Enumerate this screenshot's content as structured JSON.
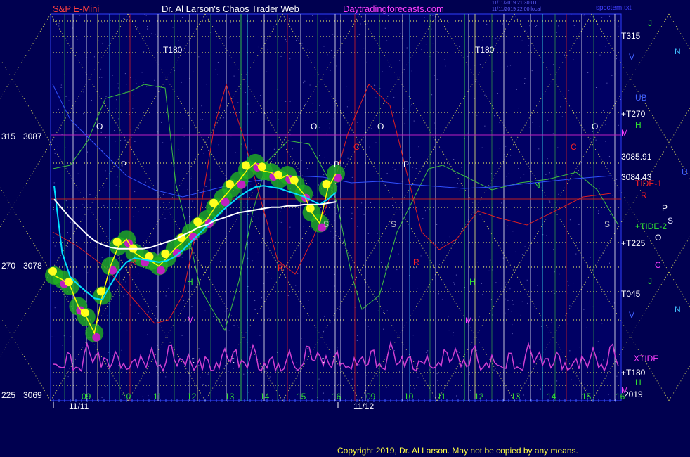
{
  "header": {
    "symbol": "S&P E-Mini",
    "title": "Dr. Al Larson's Chaos Trader Web",
    "site": "Daytradingforecasts.com",
    "stamp1": "11/11/2019 21:30 UT",
    "stamp2": "11/11/2019 22:00 local",
    "file": "spcctem.txt"
  },
  "copyright": "Copyright 2019, Dr. Al Larson. May not be copied by any means.",
  "colors": {
    "background": "#000050",
    "plot": "#000064",
    "price": "#ffff00",
    "ema": "#00e0ff",
    "sma": "#ffffff",
    "green_line": "#40c040",
    "red_line": "#e02020",
    "tide": "#d040d0",
    "grid": "#ffff60"
  },
  "chart_data": {
    "type": "line",
    "title": "S&P E-Mini",
    "ylim": [
      3069,
      3090
    ],
    "y_ticks": [
      {
        "angle": "315",
        "price": "3087"
      },
      {
        "angle": "270",
        "price": "3078"
      },
      {
        "angle": "225",
        "price": "3069"
      }
    ],
    "date_labels": [
      "11/11",
      "11/12"
    ],
    "hour_labels_day1": [
      "09",
      "10",
      "11",
      "12",
      "13",
      "14",
      "15",
      "16"
    ],
    "hour_labels_day2": [
      "09",
      "10",
      "11",
      "12",
      "13",
      "14",
      "15",
      "16"
    ],
    "price_labels": [
      "3085.91",
      "3084.43"
    ],
    "right_labels": [
      "T315",
      "+T270",
      "+T225",
      "T045",
      "+T180",
      "2019"
    ],
    "planet_labels": [
      "J",
      "N",
      "V",
      "UB",
      "H",
      "M",
      "U",
      "TIDE-1",
      "R",
      "P",
      "S",
      "+TIDE-2",
      "O",
      "C",
      "J",
      "N",
      "V",
      "XTIDE",
      "H",
      "M"
    ],
    "inner_labels": [
      "T180",
      "T180",
      "O",
      "O",
      "O",
      "O",
      "P",
      "P",
      "P",
      "S",
      "S",
      "S",
      "R",
      "R",
      "R",
      "M",
      "M",
      "H",
      "H",
      "C",
      "C",
      "N",
      "t",
      "t",
      "t"
    ],
    "series": [
      {
        "values": [
          3078.3,
          3078.0,
          3077.5,
          3076.0,
          3075.2,
          3074.0,
          3076.8,
          3079.0,
          3080.5,
          3081.0,
          3080.0,
          3079.6,
          3079.4,
          3079.0,
          3079.6,
          3080.3,
          3080.8,
          3081.5,
          3082.0,
          3082.5,
          3083.4,
          3084.1,
          3084.8,
          3085.4,
          3086.2,
          3086.7,
          3086.1,
          3086.0,
          3085.5,
          3085.8,
          3085.1,
          3084.4,
          3083.0,
          3082.2,
          3084.8,
          3085.9
        ]
      },
      {
        "values": [
          3085.0,
          3080.0,
          3078.2,
          3077.6,
          3077.1,
          3076.6,
          3076.5,
          3077.6,
          3078.6,
          3079.3,
          3079.6,
          3079.5,
          3079.4,
          3079.3,
          3079.4,
          3079.7,
          3080.2,
          3080.8,
          3081.4,
          3082.0,
          3082.6,
          3083.2,
          3083.7,
          3084.2,
          3084.6,
          3084.9,
          3085.0,
          3084.9,
          3084.8,
          3084.6,
          3084.4,
          3084.2,
          3083.9,
          3083.6,
          3084.0,
          3084.5
        ]
      },
      {
        "values": [
          3084.0,
          3083.3,
          3082.6,
          3082.0,
          3081.4,
          3080.9,
          3080.6,
          3080.4,
          3080.3,
          3080.3,
          3080.3,
          3080.3,
          3080.4,
          3080.6,
          3080.8,
          3081.0,
          3081.3,
          3081.6,
          3081.9,
          3082.1,
          3082.4,
          3082.6,
          3082.8,
          3083.0,
          3083.1,
          3083.2,
          3083.3,
          3083.4,
          3083.4,
          3083.5,
          3083.5,
          3083.6,
          3083.6,
          3083.6,
          3083.7,
          3083.8
        ]
      }
    ]
  }
}
